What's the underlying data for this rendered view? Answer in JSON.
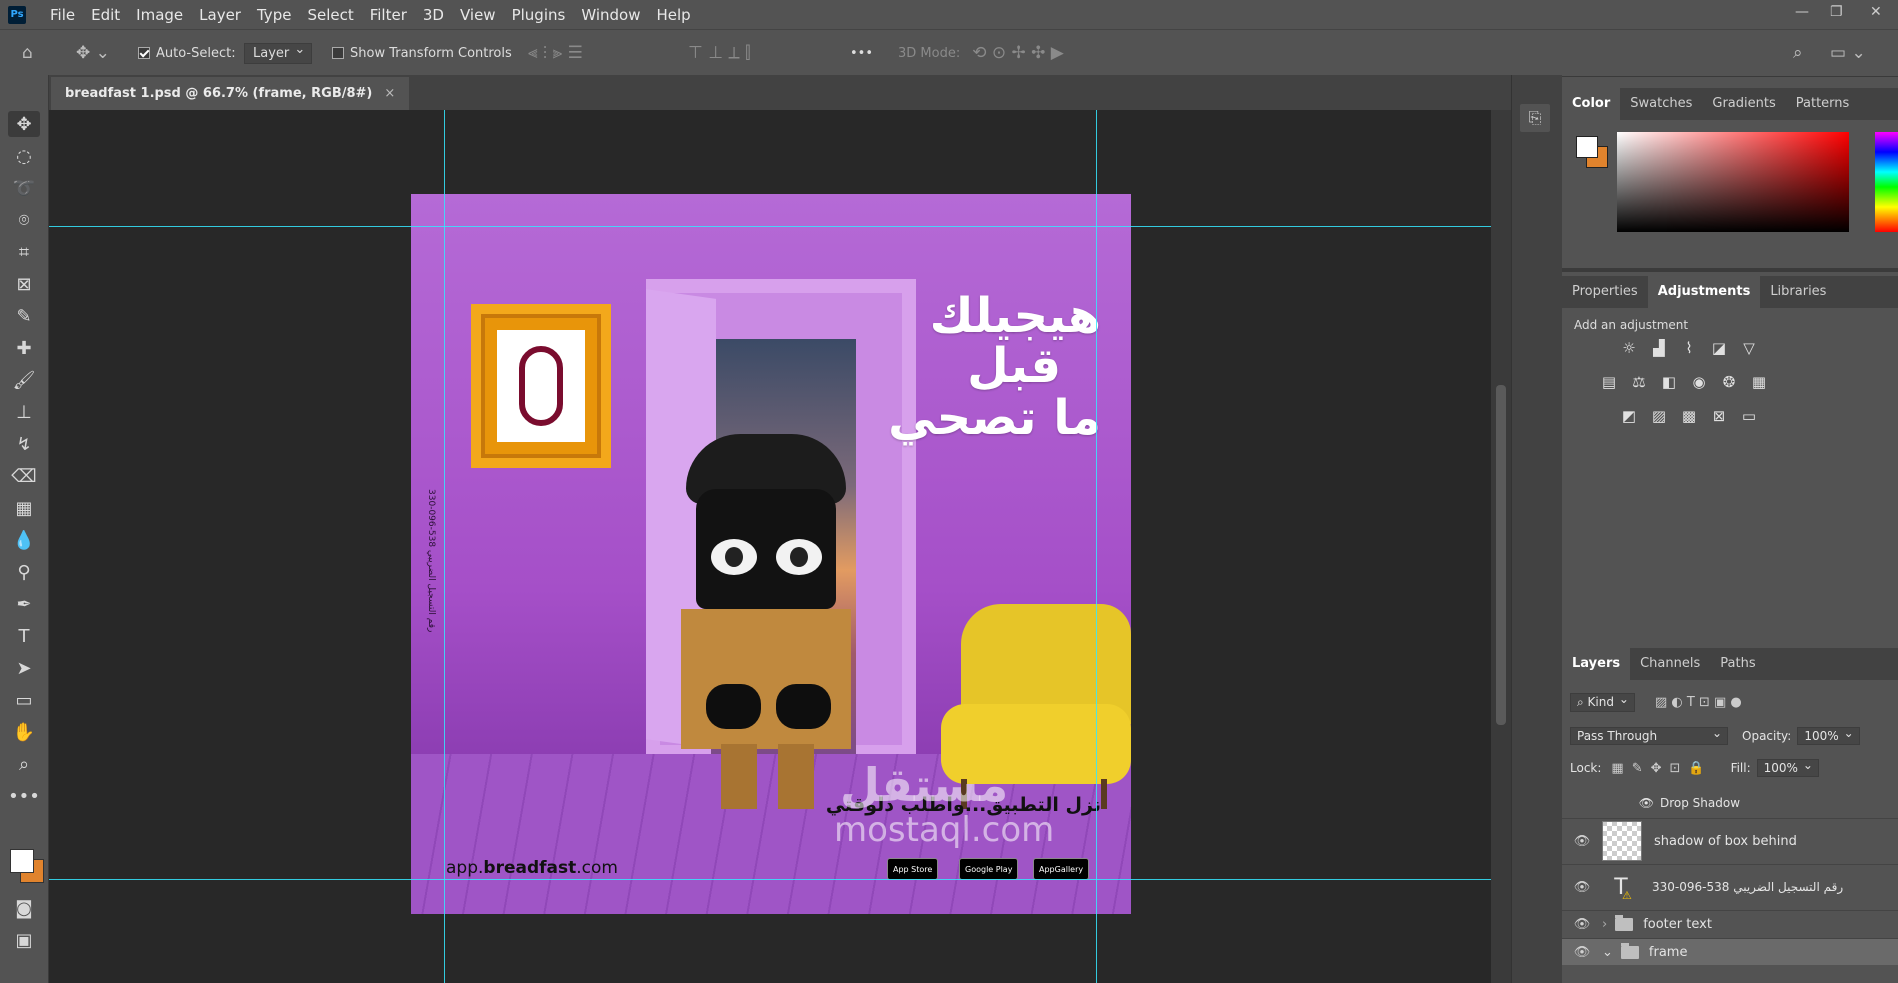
{
  "app": {
    "logo": "Ps"
  },
  "menu": [
    "File",
    "Edit",
    "Image",
    "Layer",
    "Type",
    "Select",
    "Filter",
    "3D",
    "View",
    "Plugins",
    "Window",
    "Help"
  ],
  "window_controls": {
    "minimize": "—",
    "restore": "❐",
    "close": "✕"
  },
  "options": {
    "auto_select_label": "Auto-Select:",
    "auto_select_checked": true,
    "auto_select_target": "Layer",
    "show_transform_label": "Show Transform Controls",
    "show_transform_checked": false,
    "more": "•••",
    "mode_3d": "3D Mode:"
  },
  "document": {
    "tab_title": "breadfast 1.psd @ 66.7% (frame, RGB/8#)",
    "tab_close": "×"
  },
  "artwork": {
    "headline_line1": "هيجيلك",
    "headline_line2": "قبل",
    "headline_line3": "ما تصحي",
    "tagline": "نزل التطبيق...واطلب دلوقتي",
    "url_prefix": "app.",
    "url_brand": "breadfast",
    "url_suffix": ".com",
    "vertical_text": "رقم التسجيل الضريبي 538-096-330",
    "stores": [
      "App Store",
      "Google Play",
      "AppGallery"
    ],
    "watermark_ar": "مستقل",
    "watermark_en": "mostaql.com"
  },
  "color_panel": {
    "tabs": [
      "Color",
      "Swatches",
      "Gradients",
      "Patterns"
    ],
    "active": "Color",
    "foreground": "#ffffff",
    "background": "#e0832d"
  },
  "adjustments_panel": {
    "tabs": [
      "Properties",
      "Adjustments",
      "Libraries"
    ],
    "active": "Adjustments",
    "label": "Add an adjustment"
  },
  "layers_panel": {
    "tabs": [
      "Layers",
      "Channels",
      "Paths"
    ],
    "active": "Layers",
    "filter_kind": "Kind",
    "blend_mode": "Pass Through",
    "opacity_label": "Opacity:",
    "opacity_value": "100%",
    "lock_label": "Lock:",
    "fill_label": "Fill:",
    "fill_value": "100%",
    "layers": [
      {
        "name": "Drop Shadow",
        "type": "effect"
      },
      {
        "name": "shadow of box behind",
        "type": "pixel"
      },
      {
        "name": "رقم التسجيل الضريبي  538-096-330",
        "type": "text"
      },
      {
        "name": "footer text",
        "type": "group"
      },
      {
        "name": "frame",
        "type": "group"
      }
    ]
  }
}
